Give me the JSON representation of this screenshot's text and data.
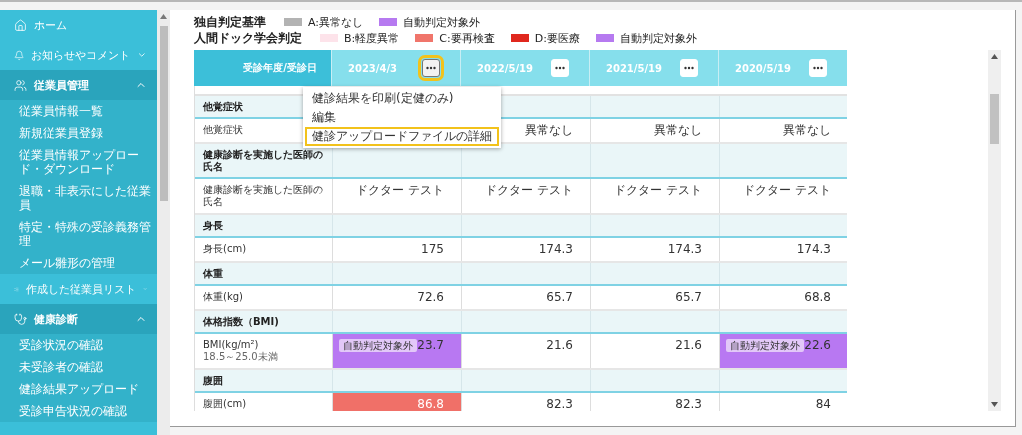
{
  "sidebar": {
    "items": [
      {
        "kind": "link",
        "label": "ホーム"
      },
      {
        "kind": "group",
        "label": "お知らせやコメント",
        "expanded": false
      },
      {
        "kind": "group",
        "label": "従業員管理",
        "expanded": true,
        "children": [
          {
            "label": "従業員情報一覧"
          },
          {
            "label": "新規従業員登録"
          },
          {
            "label": "従業員情報アップロード・ダウンロード"
          },
          {
            "label": "退職・非表示にした従業員"
          },
          {
            "label": "特定・特殊の受診義務管理"
          },
          {
            "label": "メール雛形の管理"
          }
        ]
      },
      {
        "kind": "group",
        "label": "作成した従業員リスト",
        "expanded": false
      },
      {
        "kind": "group",
        "label": "健康診断",
        "expanded": true,
        "children": [
          {
            "label": "受診状況の確認"
          },
          {
            "label": "未受診者の確認"
          },
          {
            "label": "健診結果アップロード"
          },
          {
            "label": "受診申告状況の確認"
          }
        ]
      }
    ]
  },
  "legend": [
    {
      "title": "独自判定基準",
      "entries": [
        {
          "label": "A:異常なし",
          "color": "#b3b3b3"
        },
        {
          "label": "自動判定対象外",
          "color": "#b67af0"
        }
      ]
    },
    {
      "title": "人間ドック学会判定",
      "entries": [
        {
          "label": "B:軽度異常",
          "color": "#fde3ea"
        },
        {
          "label": "C:要再検査",
          "color": "#f0756b"
        },
        {
          "label": "D:要医療",
          "color": "#e0281e"
        },
        {
          "label": "自動判定対象外",
          "color": "#b67af0"
        }
      ]
    }
  ],
  "table": {
    "header_label": "受診年度/受診日",
    "columns": [
      {
        "date": "2023/4/3",
        "highlighted": true
      },
      {
        "date": "2022/5/19",
        "highlighted": false
      },
      {
        "date": "2021/5/19",
        "highlighted": false
      },
      {
        "date": "2020/5/19",
        "highlighted": false
      }
    ],
    "groups": [
      {
        "title": "他覚症状",
        "rows": [
          {
            "label": "他覚症状",
            "cells": [
              {},
              {
                "value": "異常なし"
              },
              {
                "value": "異常なし"
              },
              {
                "value": "異常なし"
              }
            ]
          }
        ]
      },
      {
        "title": "健康診断を実施した医師の氏名",
        "rows": [
          {
            "label": "健康診断を実施した医師の氏名",
            "cells": [
              {
                "value": "ドクター テスト"
              },
              {
                "value": "ドクター テスト"
              },
              {
                "value": "ドクター テスト"
              },
              {
                "value": "ドクター テスト"
              }
            ]
          }
        ]
      },
      {
        "title": "身長",
        "rows": [
          {
            "label": "身長(cm)",
            "cells": [
              {
                "value": "175"
              },
              {
                "value": "174.3"
              },
              {
                "value": "174.3"
              },
              {
                "value": "174.3"
              }
            ]
          }
        ]
      },
      {
        "title": "体重",
        "rows": [
          {
            "label": "体重(kg)",
            "cells": [
              {
                "value": "72.6"
              },
              {
                "value": "65.7"
              },
              {
                "value": "65.7"
              },
              {
                "value": "68.8"
              }
            ]
          }
        ]
      },
      {
        "title": "体格指数（BMI)",
        "rows": [
          {
            "label": "BMI(kg/m²)",
            "range": "18.5～25.0未満",
            "cells": [
              {
                "value": "23.7",
                "color": "#b878f2",
                "badge": "自動判定対象外"
              },
              {
                "value": "21.6"
              },
              {
                "value": "21.6"
              },
              {
                "value": "22.6",
                "color": "#b878f2",
                "badge": "自動判定対象外"
              }
            ]
          }
        ]
      },
      {
        "title": "腹囲",
        "rows": [
          {
            "label": "腹囲(cm)",
            "cells": [
              {
                "value": "86.8",
                "color": "#f07068"
              },
              {
                "value": "82.3"
              },
              {
                "value": "82.3"
              },
              {
                "value": "84"
              }
            ]
          }
        ]
      }
    ]
  },
  "menu": {
    "items": [
      {
        "label": "健診結果を印刷(定健のみ)",
        "highlighted": false
      },
      {
        "label": "編集",
        "highlighted": false
      },
      {
        "label": "健診アップロードファイルの詳細",
        "highlighted": true
      }
    ]
  }
}
